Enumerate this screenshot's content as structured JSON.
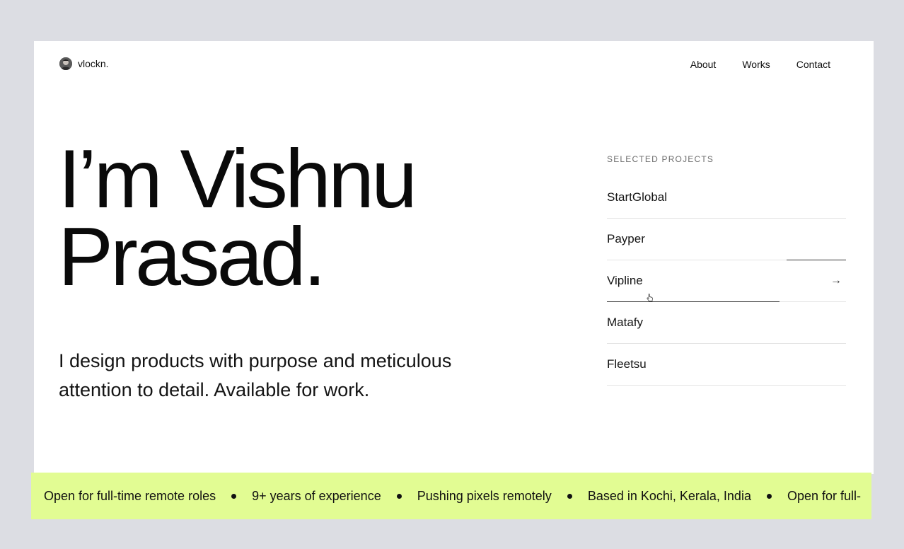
{
  "header": {
    "brand_name": "vlockn.",
    "nav": [
      {
        "label": "About"
      },
      {
        "label": "Works"
      },
      {
        "label": "Contact"
      }
    ]
  },
  "hero": {
    "title_line1": "I’m Vishnu",
    "title_line2": "Prasad.",
    "subtitle": "I design products with purpose and meticulous attention to detail. Available for work."
  },
  "projects": {
    "heading": "SELECTED PROJECTS",
    "items": [
      {
        "label": "StartGlobal"
      },
      {
        "label": "Payper"
      },
      {
        "label": "Vipline"
      },
      {
        "label": "Matafy"
      },
      {
        "label": "Fleetsu"
      }
    ],
    "active_index": 2,
    "arrow_icon": "arrow-right-icon"
  },
  "ticker": {
    "items": [
      "Open for full-time remote roles",
      "9+ years of experience",
      "Pushing pixels remotely",
      "Based in Kochi, Kerala, India",
      "Open for full-"
    ],
    "background": "#e2fc93"
  }
}
